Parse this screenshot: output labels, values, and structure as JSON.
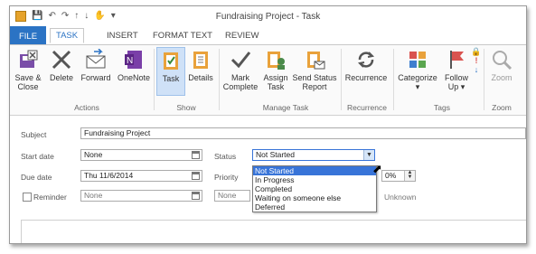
{
  "window": {
    "title": "Fundraising Project - Task"
  },
  "quick_access": [
    "app-icon",
    "save-icon",
    "undo-icon",
    "redo-icon",
    "up-icon",
    "down-icon",
    "touch-icon",
    "customize-icon"
  ],
  "tabs": [
    {
      "label": "FILE"
    },
    {
      "label": "TASK"
    },
    {
      "label": "INSERT"
    },
    {
      "label": "FORMAT TEXT"
    },
    {
      "label": "REVIEW"
    }
  ],
  "ribbon": {
    "actions": {
      "group": "Actions",
      "save_close_1": "Save &",
      "save_close_2": "Close",
      "delete": "Delete",
      "forward": "Forward",
      "onenote": "OneNote"
    },
    "show": {
      "group": "Show",
      "task": "Task",
      "details": "Details"
    },
    "manage": {
      "group": "Manage Task",
      "mark_1": "Mark",
      "mark_2": "Complete",
      "assign_1": "Assign",
      "assign_2": "Task",
      "send_1": "Send Status",
      "send_2": "Report"
    },
    "recurrence": {
      "group": "Recurrence",
      "recurrence": "Recurrence"
    },
    "tags": {
      "group": "Tags",
      "categorize": "Categorize",
      "follow_1": "Follow",
      "follow_2": "Up"
    },
    "zoom": {
      "group": "Zoom",
      "zoom": "Zoom"
    }
  },
  "form": {
    "subject_label": "Subject",
    "subject_value": "Fundraising Project",
    "start_label": "Start date",
    "start_value": "None",
    "due_label": "Due date",
    "due_value": "Thu 11/6/2014",
    "reminder_label": "Reminder",
    "reminder_date": "None",
    "reminder_time": "None",
    "status_label": "Status",
    "status_value": "Not Started",
    "priority_label": "Priority",
    "percent_value": "0%",
    "owner_value": "Unknown",
    "status_options": [
      "Not Started",
      "In Progress",
      "Completed",
      "Waiting on someone else",
      "Deferred"
    ]
  }
}
